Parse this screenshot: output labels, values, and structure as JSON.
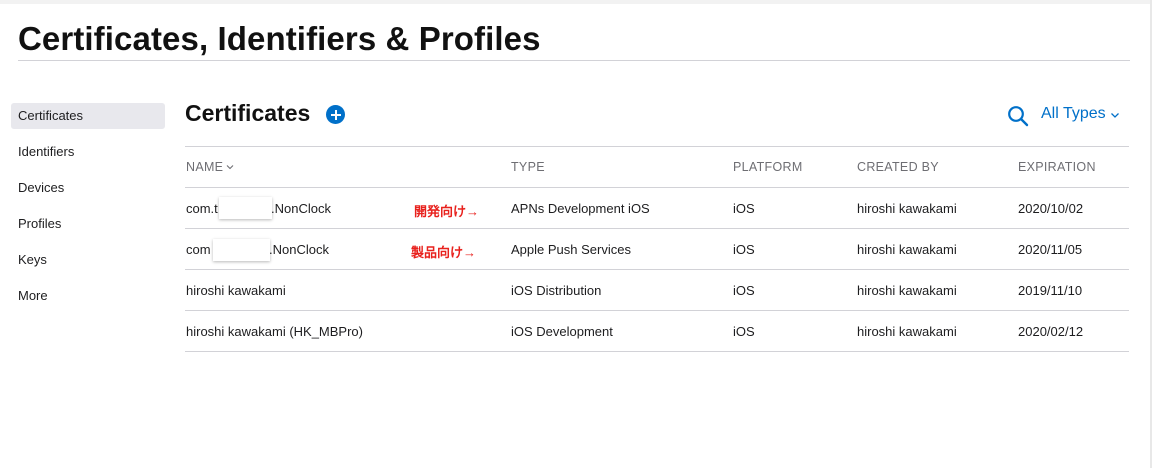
{
  "page": {
    "title": "Certificates, Identifiers & Profiles"
  },
  "sidebar": {
    "items": [
      {
        "label": "Certificates",
        "active": true
      },
      {
        "label": "Identifiers",
        "active": false
      },
      {
        "label": "Devices",
        "active": false
      },
      {
        "label": "Profiles",
        "active": false
      },
      {
        "label": "Keys",
        "active": false
      },
      {
        "label": "More",
        "active": false
      }
    ]
  },
  "section": {
    "title": "Certificates",
    "add_icon": "plus-circle-icon",
    "search_icon": "search-icon",
    "filter_label": "All Types"
  },
  "table": {
    "headers": {
      "name": "NAME",
      "type": "TYPE",
      "platform": "PLATFORM",
      "created_by": "CREATED BY",
      "expiration": "EXPIRATION"
    },
    "rows": [
      {
        "name_prefix": "com.t",
        "name_suffix": ".NonClock",
        "note": "開発向け→",
        "type": "APNs Development iOS",
        "platform": "iOS",
        "created_by": "hiroshi kawakami",
        "expiration": "2020/10/02"
      },
      {
        "name_prefix": "com",
        "name_suffix": ".NonClock",
        "note": "製品向け→",
        "type": "Apple Push Services",
        "platform": "iOS",
        "created_by": "hiroshi kawakami",
        "expiration": "2020/11/05"
      },
      {
        "name": "hiroshi kawakami",
        "type": "iOS Distribution",
        "platform": "iOS",
        "created_by": "hiroshi kawakami",
        "expiration": "2019/11/10"
      },
      {
        "name": "hiroshi kawakami (HK_MBPro)",
        "type": "iOS Development",
        "platform": "iOS",
        "created_by": "hiroshi kawakami",
        "expiration": "2020/02/12"
      }
    ]
  },
  "colors": {
    "accent": "#0070c9",
    "annotation": "#e8211d",
    "sidebar_active": "#e8e8ed"
  }
}
